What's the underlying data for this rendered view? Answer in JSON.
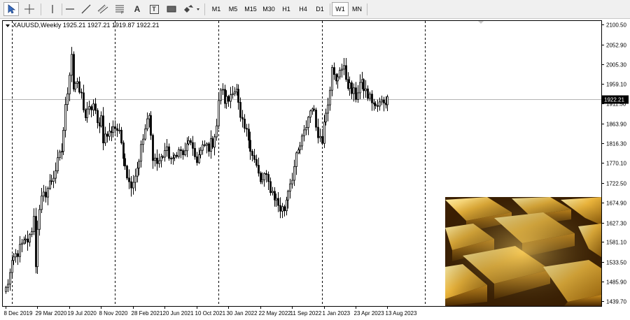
{
  "toolbar": {
    "tools": [
      {
        "name": "cursor-icon"
      },
      {
        "name": "crosshair-icon"
      },
      {
        "name": "vertical-line-icon"
      },
      {
        "name": "horizontal-line-icon"
      },
      {
        "name": "trend-line-icon"
      },
      {
        "name": "equidistant-channel-icon"
      },
      {
        "name": "fibonacci-icon"
      },
      {
        "name": "text-tool-icon",
        "label": "A"
      },
      {
        "name": "text-label-icon",
        "label": "T"
      },
      {
        "name": "rectangle-icon"
      },
      {
        "name": "shapes-dropdown-icon"
      }
    ],
    "timeframes": [
      "M1",
      "M5",
      "M15",
      "M30",
      "H1",
      "H4",
      "D1",
      "W1",
      "MN"
    ],
    "active_timeframe": "W1"
  },
  "chart_data": {
    "type": "candlestick",
    "symbol_header": "XAUUSD,Weekly  1925.21 1927.21 1919.87 1922.21",
    "current_price_label": "1922.21",
    "current_price": 1922.21,
    "ylim": [
      1428.0,
      2111.0
    ],
    "y_ticks": [
      "2100.50",
      "2052.90",
      "2005.30",
      "1959.10",
      "1911.50",
      "1863.90",
      "1816.30",
      "1770.10",
      "1722.50",
      "1674.90",
      "1627.30",
      "1581.10",
      "1533.50",
      "1485.90",
      "1439.70"
    ],
    "x_ticks": [
      {
        "label": "8 Dec 2019",
        "week": 0
      },
      {
        "label": "29 Mar 2020",
        "week": 16
      },
      {
        "label": "19 Jul 2020",
        "week": 32
      },
      {
        "label": "8 Nov 2020",
        "week": 48
      },
      {
        "label": "28 Feb 2021",
        "week": 64
      },
      {
        "label": "20 Jun 2021",
        "week": 80
      },
      {
        "label": "10 Oct 2021",
        "week": 96
      },
      {
        "label": "30 Jan 2022",
        "week": 112
      },
      {
        "label": "22 May 2022",
        "week": 128
      },
      {
        "label": "11 Sep 2022",
        "week": 144
      },
      {
        "label": "1 Jan 2023",
        "week": 160
      },
      {
        "label": "23 Apr 2023",
        "week": 176
      },
      {
        "label": "13 Aug 2023",
        "week": 192
      }
    ],
    "period_separators_week": [
      3,
      55,
      107,
      159,
      211
    ],
    "keypoints": [
      [
        0,
        1468
      ],
      [
        4,
        1540
      ],
      [
        8,
        1572
      ],
      [
        12,
        1590
      ],
      [
        14,
        1640
      ],
      [
        15,
        1530
      ],
      [
        16,
        1620
      ],
      [
        18,
        1680
      ],
      [
        20,
        1700
      ],
      [
        24,
        1740
      ],
      [
        28,
        1800
      ],
      [
        30,
        1900
      ],
      [
        33,
        2035
      ],
      [
        34,
        1950
      ],
      [
        35,
        1960
      ],
      [
        38,
        1930
      ],
      [
        40,
        1880
      ],
      [
        44,
        1910
      ],
      [
        46,
        1860
      ],
      [
        48,
        1880
      ],
      [
        49,
        1830
      ],
      [
        52,
        1840
      ],
      [
        54,
        1860
      ],
      [
        56,
        1850
      ],
      [
        58,
        1820
      ],
      [
        60,
        1770
      ],
      [
        62,
        1720
      ],
      [
        64,
        1730
      ],
      [
        66,
        1760
      ],
      [
        70,
        1850
      ],
      [
        72,
        1880
      ],
      [
        73,
        1830
      ],
      [
        74,
        1790
      ],
      [
        76,
        1770
      ],
      [
        78,
        1780
      ],
      [
        80,
        1800
      ],
      [
        82,
        1790
      ],
      [
        84,
        1770
      ],
      [
        86,
        1800
      ],
      [
        90,
        1790
      ],
      [
        92,
        1830
      ],
      [
        94,
        1790
      ],
      [
        96,
        1780
      ],
      [
        100,
        1810
      ],
      [
        102,
        1810
      ],
      [
        104,
        1820
      ],
      [
        106,
        1860
      ],
      [
        107,
        1910
      ],
      [
        108,
        1950
      ],
      [
        110,
        1920
      ],
      [
        112,
        1920
      ],
      [
        114,
        1950
      ],
      [
        116,
        1940
      ],
      [
        118,
        1870
      ],
      [
        120,
        1850
      ],
      [
        122,
        1830
      ],
      [
        126,
        1760
      ],
      [
        128,
        1720
      ],
      [
        130,
        1740
      ],
      [
        132,
        1720
      ],
      [
        134,
        1700
      ],
      [
        136,
        1680
      ],
      [
        138,
        1660
      ],
      [
        140,
        1660
      ],
      [
        142,
        1710
      ],
      [
        144,
        1740
      ],
      [
        146,
        1780
      ],
      [
        148,
        1810
      ],
      [
        150,
        1840
      ],
      [
        152,
        1880
      ],
      [
        154,
        1910
      ],
      [
        156,
        1860
      ],
      [
        158,
        1830
      ],
      [
        159,
        1820
      ],
      [
        160,
        1880
      ],
      [
        162,
        1920
      ],
      [
        164,
        1990
      ],
      [
        166,
        1960
      ],
      [
        168,
        2000
      ],
      [
        170,
        1990
      ],
      [
        172,
        1960
      ],
      [
        174,
        1940
      ],
      [
        176,
        1930
      ],
      [
        178,
        1960
      ],
      [
        180,
        1950
      ],
      [
        182,
        1930
      ],
      [
        184,
        1920
      ],
      [
        186,
        1900
      ],
      [
        188,
        1910
      ],
      [
        190,
        1920
      ],
      [
        192,
        1920
      ]
    ],
    "grid": false
  }
}
